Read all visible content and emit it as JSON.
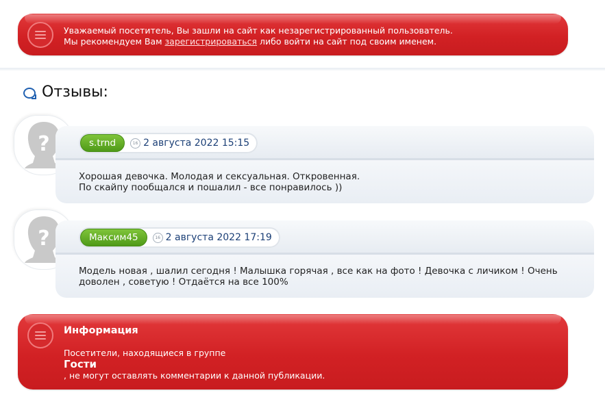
{
  "guest_notice": {
    "line1": "Уважаемый посетитель, Вы зашли на сайт как незарегистрированный пользователь.",
    "line2_before": "Мы рекомендуем Вам ",
    "register_link": "зарегистрироваться",
    "line2_after": " либо войти на сайт под своим именем."
  },
  "reviews": {
    "title": "Отзывы:",
    "items": [
      {
        "author": "s.trnd",
        "date": "2 августа 2022 15:15",
        "text_line1": "Хорошая девочка. Молодая и сексуальная. Откровенная.",
        "text_line2": "По скайпу пообщался и пошалил - все понравилось ))"
      },
      {
        "author": "Максим45",
        "date": "2 августа 2022 17:19",
        "text_line1": "Модель новая , шалил сегодня ! Малышка горячая , все как на фото ! Девочка с личиком ! Очень",
        "text_line2": "доволен , советую ! Отдаётся на все 100%"
      }
    ]
  },
  "info_notice": {
    "title": "Информация",
    "line1": "Посетители, находящиеся в группе",
    "group": "Гости",
    "line2": ", не могут оставлять комментарии к данной публикации."
  },
  "colors": {
    "notice_red": "#d22124",
    "author_green": "#4f9a18",
    "date_blue": "#1b3f76"
  }
}
